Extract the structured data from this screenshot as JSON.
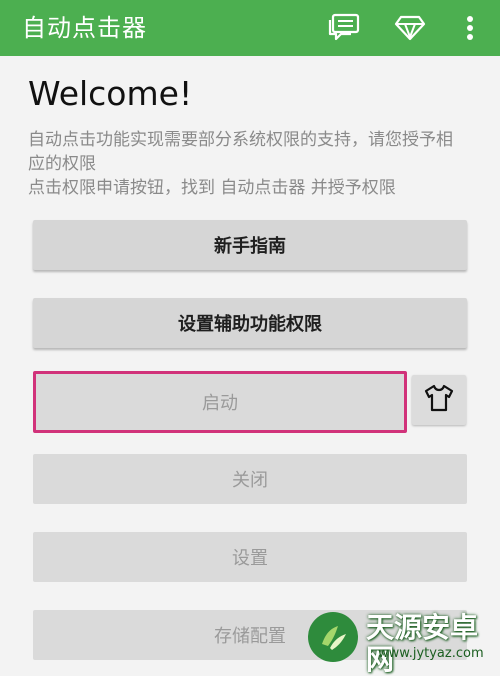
{
  "appbar": {
    "title": "自动点击器",
    "icons": [
      "chat-icon",
      "diamond-icon",
      "more-vert-icon"
    ]
  },
  "welcome": "Welcome!",
  "description": {
    "line1": "自动点击功能实现需要部分系统权限的支持，请您授予相应的权限",
    "line2": "点击权限申请按钮，找到 自动点击器 并授予权限"
  },
  "buttons": {
    "guide": "新手指南",
    "accessibility": "设置辅助功能权限",
    "start": "启动",
    "close": "关闭",
    "settings": "设置",
    "storage": "存储配置"
  },
  "skin_button_icon": "tshirt-icon",
  "watermark": {
    "title": "天源安卓网",
    "url": "www.jytyaz.com"
  },
  "colors": {
    "appbar": "#4caf50",
    "highlight_border": "#d1327a",
    "button_bg": "#d6d6d6"
  }
}
